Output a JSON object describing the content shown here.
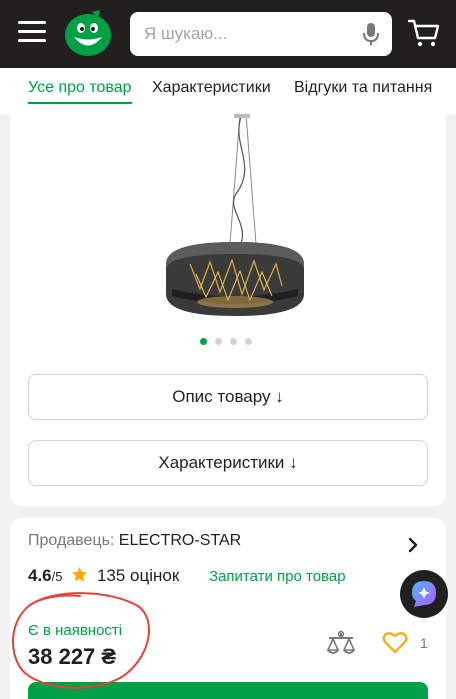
{
  "header": {
    "search_placeholder": "Я шукаю...",
    "icons": [
      "menu-icon",
      "logo",
      "microphone-icon",
      "cart-icon"
    ]
  },
  "tabs": [
    {
      "label": "Усе про товар",
      "active": true
    },
    {
      "label": "Характеристики",
      "active": false
    },
    {
      "label": "Відгуки та питання",
      "active": false
    }
  ],
  "gallery": {
    "slides_count": 4,
    "active_slide": 1
  },
  "buttons": {
    "description": "Опис товару ↓",
    "characteristics": "Характеристики ↓"
  },
  "seller": {
    "label": "Продавець:",
    "name": "ELECTRO-STAR"
  },
  "rating": {
    "value": "4.6",
    "out_of": "/5",
    "reviews": "135 оцінок",
    "ask_link": "Запитати про товар"
  },
  "availability": "Є в наявності",
  "price": "38 227 ₴",
  "favorites_count": "1",
  "colors": {
    "brand_green": "#00a046",
    "header_dark": "#221f1f",
    "star_orange": "#ffa900",
    "annotation_red": "#e0453a",
    "assistant_purple": "#7b61ff"
  }
}
